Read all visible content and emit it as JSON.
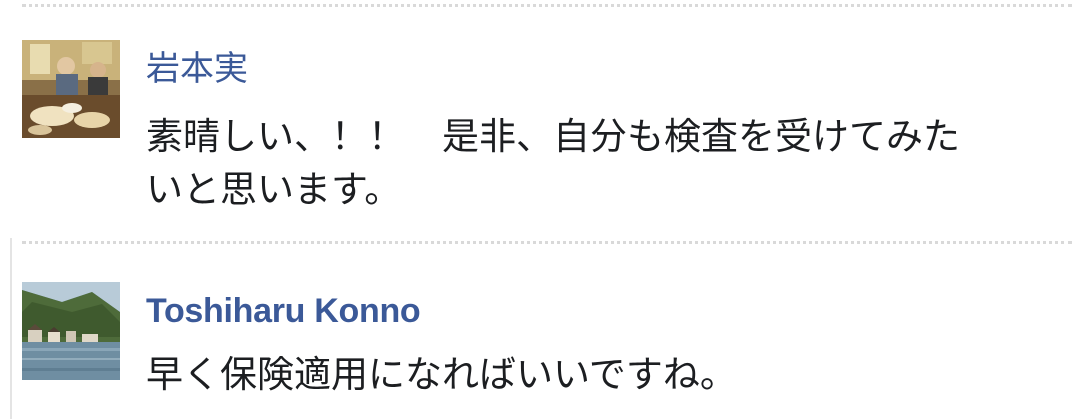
{
  "comments": [
    {
      "author": "岩本実",
      "text_lines": [
        "素晴しい、！！　是非、自分も検査を受けてみた",
        "いと思います。"
      ],
      "avatar_icon": "photo-avatar-indoor-party"
    },
    {
      "author": "Toshiharu Konno",
      "text_lines": [
        "早く保険適用になればいいですね。"
      ],
      "avatar_icon": "photo-avatar-lakeside-village"
    }
  ],
  "colors": {
    "author_link": "#3b5998",
    "body_text": "#1c1e21",
    "divider": "#d9d9d9"
  }
}
